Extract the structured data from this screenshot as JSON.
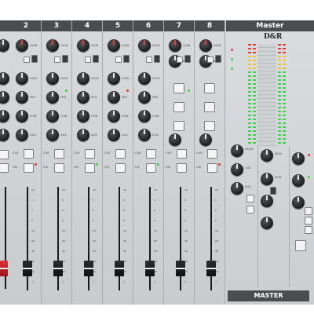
{
  "channels": [
    {
      "number": "2",
      "knob_labels": [
        "GAIN",
        "HIGH",
        "MID",
        "LOW",
        "AUX"
      ],
      "button_labels": [
        "CUE",
        "ON"
      ]
    },
    {
      "number": "3",
      "knob_labels": [
        "GAIN",
        "HIGH",
        "MID",
        "LOW",
        "AUX"
      ],
      "button_labels": [
        "CUE",
        "ON"
      ]
    },
    {
      "number": "4",
      "knob_labels": [
        "GAIN",
        "HIGH",
        "MID",
        "LOW",
        "AUX"
      ],
      "button_labels": [
        "CUE",
        "ON"
      ]
    },
    {
      "number": "5",
      "knob_labels": [
        "GAIN",
        "HIGH",
        "MID",
        "LOW",
        "AUX"
      ],
      "button_labels": [
        "CUE",
        "ON"
      ]
    },
    {
      "number": "6",
      "knob_labels": [
        "GAIN",
        "HIGH",
        "MID",
        "LOW",
        "AUX"
      ],
      "button_labels": [
        "CUE",
        "ON"
      ]
    },
    {
      "number": "7",
      "knob_labels": [
        "GAIN",
        "BAL"
      ],
      "button_labels": [
        "CUE",
        "ON"
      ]
    },
    {
      "number": "8",
      "knob_labels": [
        "GAIN",
        "BAL"
      ],
      "button_labels": [
        "CUE",
        "ON"
      ]
    }
  ],
  "master": {
    "header": "Master",
    "logo": "D&R",
    "footer": "MASTER",
    "knob_labels": [
      "HEAD",
      "CUE",
      "AUX",
      "MON",
      "PGM"
    ]
  },
  "fader_scale": [
    "10",
    "5",
    "0",
    "5",
    "10",
    "20",
    "30",
    "40",
    "60",
    "∞"
  ],
  "colors": {
    "panel": "#cfd2d4",
    "header": "#4a4c4f",
    "led_green": "#3fd04a",
    "led_yellow": "#f1c232",
    "led_red": "#e53c2f",
    "red_cap": "#c8202a"
  }
}
